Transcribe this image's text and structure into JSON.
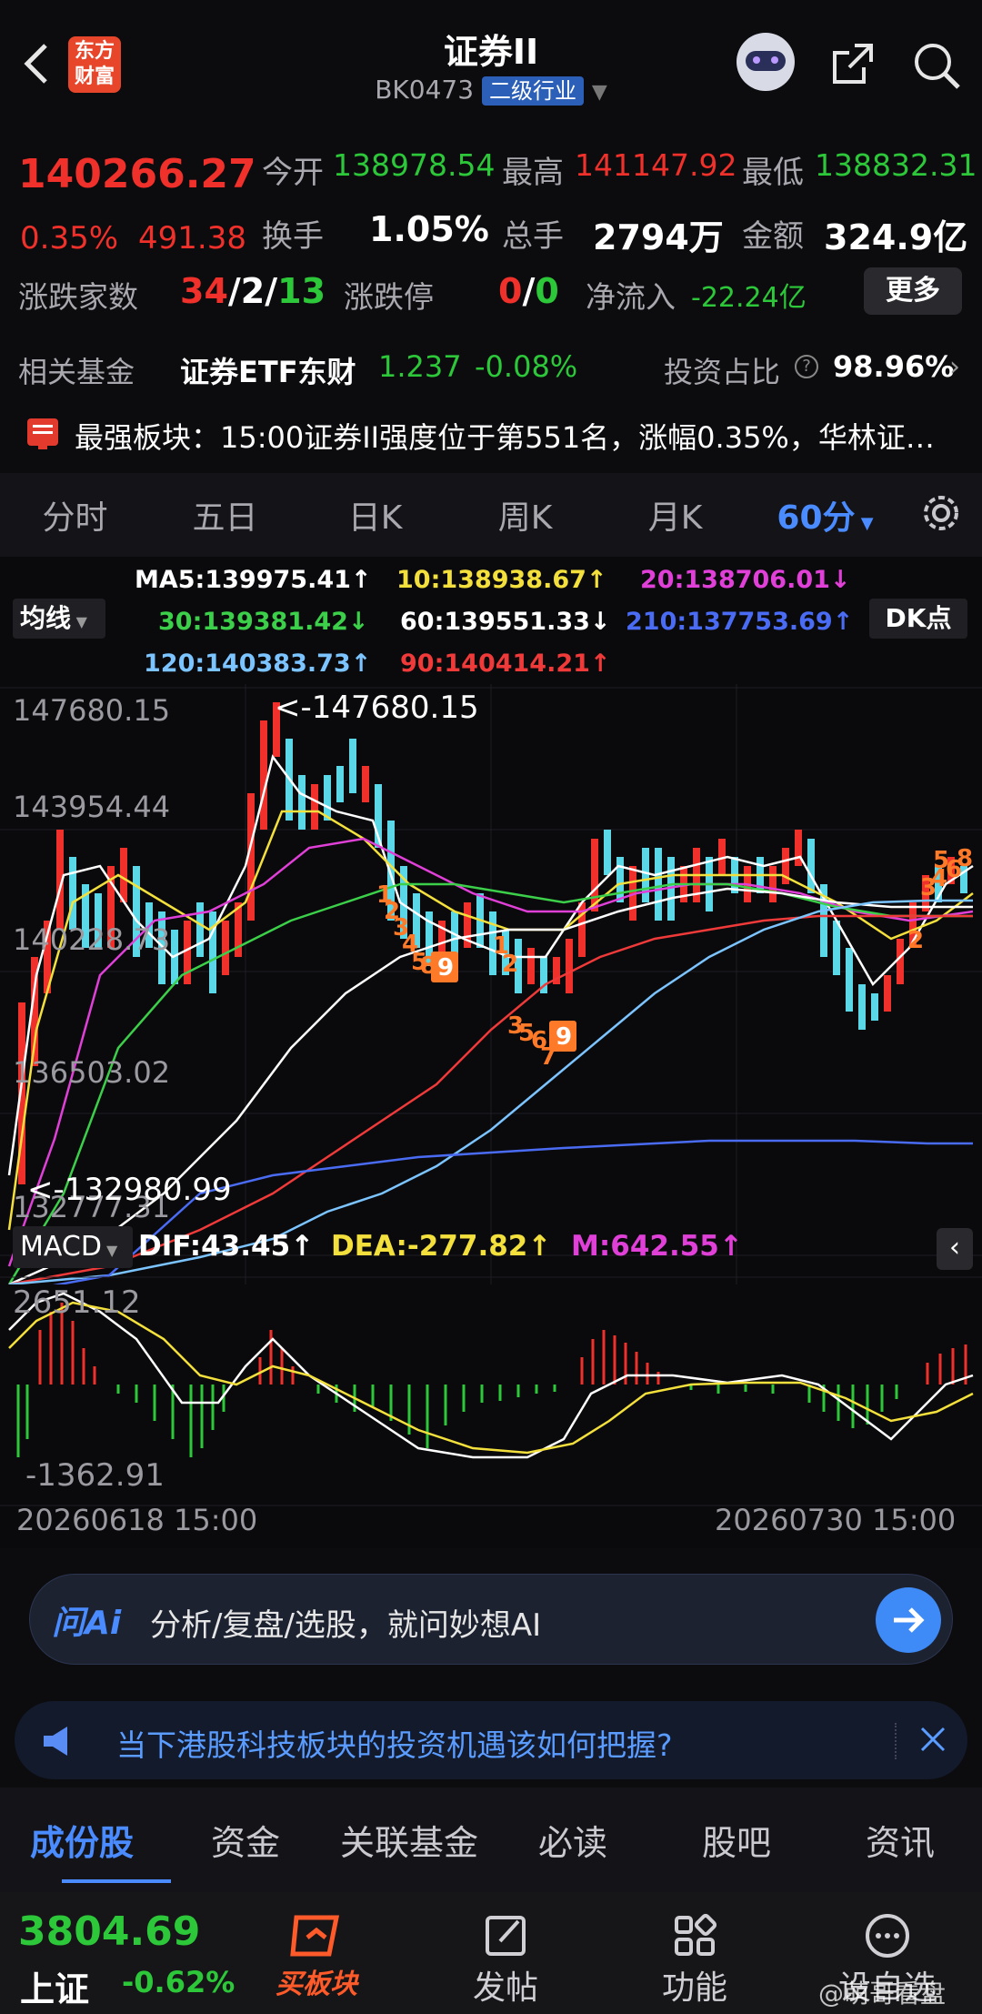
{
  "header": {
    "title": "证券II",
    "code": "BK0473",
    "industry_badge": "二级行业",
    "logo_line1": "东方",
    "logo_line2": "财富"
  },
  "quote": {
    "price": "140266.27",
    "change_pct": "0.35%",
    "change_abs": "491.38",
    "open_label": "今开",
    "open": "138978.54",
    "high_label": "最高",
    "high": "141147.92",
    "low_label": "最低",
    "low": "138832.31",
    "turnover_label": "换手",
    "turnover": "1.05%",
    "volume_label": "总手",
    "volume": "2794万",
    "amount_label": "金额",
    "amount": "324.9亿",
    "adv_label": "涨跌家数",
    "adv_up": "34",
    "adv_flat": "2",
    "adv_down": "13",
    "limit_label": "涨跌停",
    "limit_up": "0",
    "limit_down": "0",
    "netflow_label": "净流入",
    "netflow": "-22.24亿",
    "more_button": "更多"
  },
  "fund": {
    "label": "相关基金",
    "name": "证券ETF东财",
    "price": "1.237",
    "change": "-0.08%",
    "ratio_label": "投资占比",
    "ratio": "98.96%"
  },
  "notice": {
    "text": "最强板块：15:00证券II强度位于第551名，涨幅0.35%，华林证…"
  },
  "periods": [
    "分时",
    "五日",
    "日K",
    "周K",
    "月K",
    "60分"
  ],
  "ma": {
    "selector": "均线",
    "dk_button": "DK点",
    "ma5": "MA5:139975.41↑",
    "ma10": "10:138938.67↑",
    "ma20": "20:138706.01↓",
    "ma30": "30:139381.42↓",
    "ma60": "60:139551.33↓",
    "ma210": "210:137753.69↑",
    "ma120": "120:140383.73↑",
    "ma90": "90:140414.21↑"
  },
  "price_axis": {
    "labels": [
      "147680.15",
      "143954.44",
      "140228.73",
      "136503.02",
      "132777.31"
    ],
    "max_marker": "<-147680.15",
    "min_marker": "<-132980.99"
  },
  "macd": {
    "selector": "MACD",
    "dif": "DIF:43.45↑",
    "dea": "DEA:-277.82↑",
    "m": "M:642.55↑",
    "top": "2651.12",
    "bottom": "-1362.91"
  },
  "dates": {
    "start": "20260618 15:00",
    "end": "20260730 15:00"
  },
  "ai": {
    "badge": "问Ai",
    "prompt": "分析/复盘/选股，就问妙想AI"
  },
  "news": {
    "text": "当下港股科技板块的投资机遇该如何把握?"
  },
  "subtabs": [
    "成份股",
    "资金",
    "关联基金",
    "必读",
    "股吧",
    "资讯"
  ],
  "bottom": {
    "index_value": "3804.69",
    "index_name": "上证",
    "index_change": "-0.62%",
    "buy_label": "买板块",
    "post_label": "发帖",
    "func_label": "功能",
    "watch_label": "设自选",
    "watermark": "@萌哥看盘"
  },
  "colors": {
    "up": "#f0302a",
    "down": "#2cc83a",
    "accent": "#4a8cff"
  }
}
